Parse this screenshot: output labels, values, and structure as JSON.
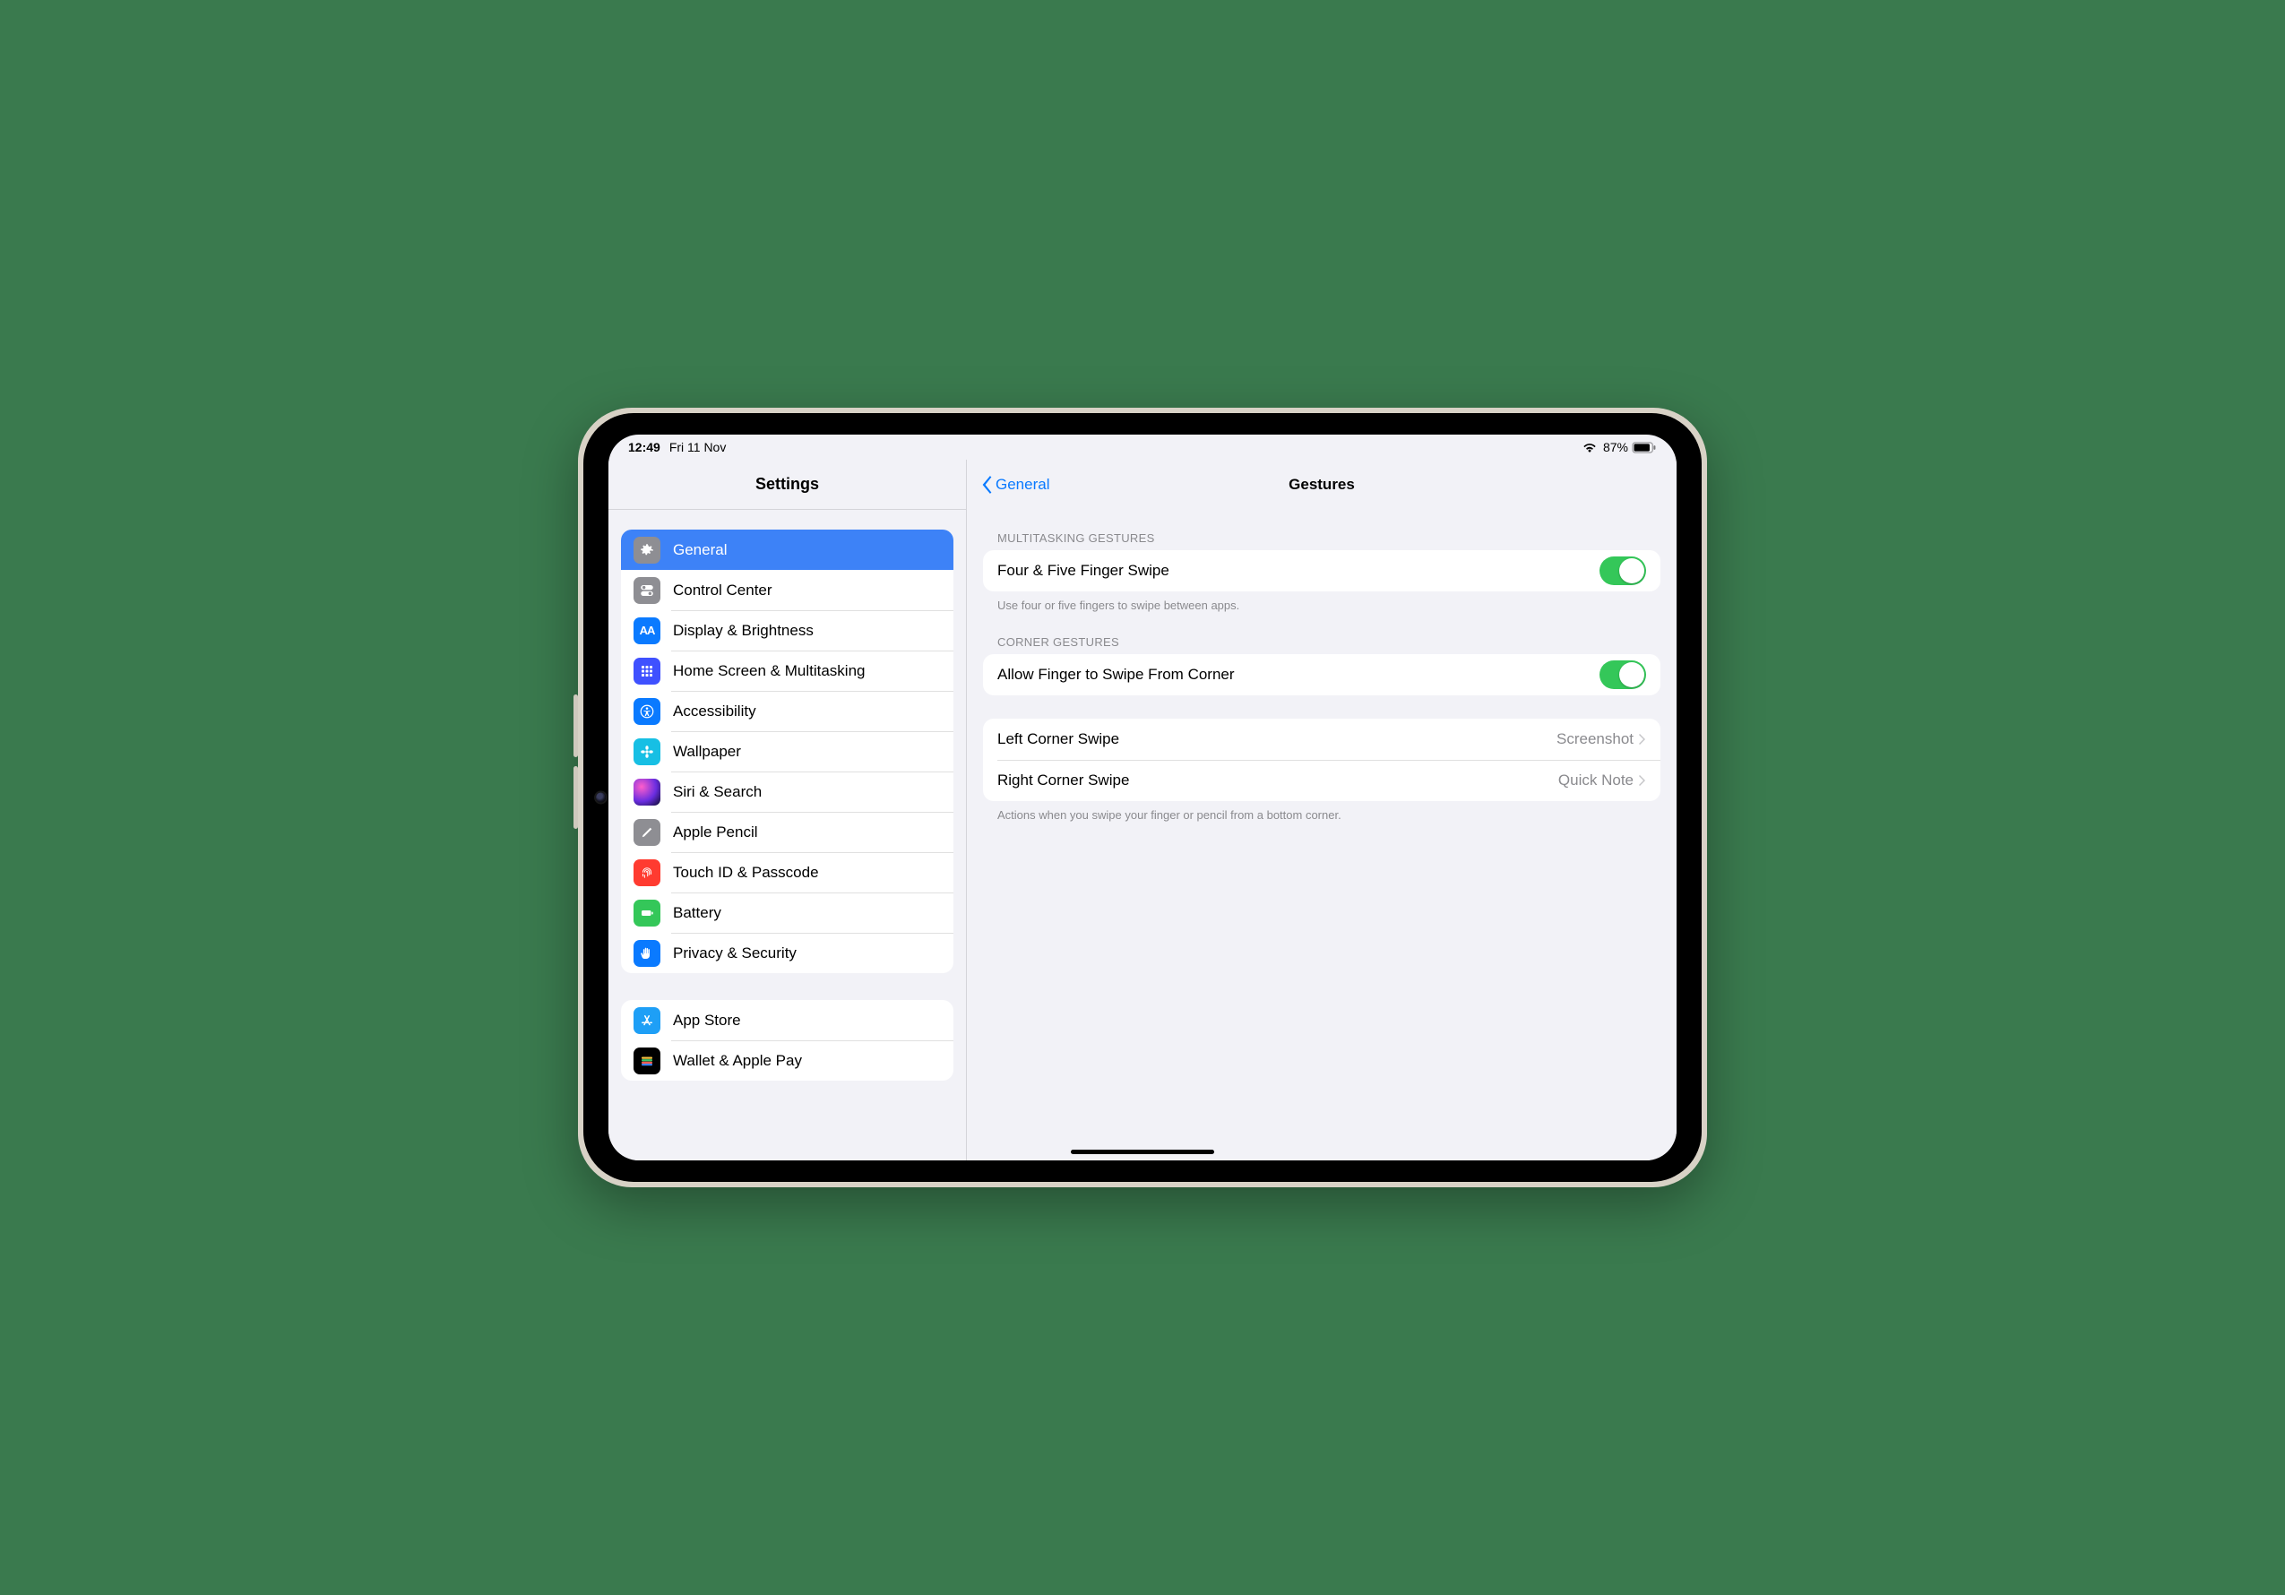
{
  "status": {
    "time": "12:49",
    "date": "Fri 11 Nov",
    "battery_pct": "87%"
  },
  "sidebar": {
    "title": "Settings",
    "group1": [
      {
        "label": "General"
      },
      {
        "label": "Control Center"
      },
      {
        "label": "Display & Brightness"
      },
      {
        "label": "Home Screen & Multitasking"
      },
      {
        "label": "Accessibility"
      },
      {
        "label": "Wallpaper"
      },
      {
        "label": "Siri & Search"
      },
      {
        "label": "Apple Pencil"
      },
      {
        "label": "Touch ID & Passcode"
      },
      {
        "label": "Battery"
      },
      {
        "label": "Privacy & Security"
      }
    ],
    "group2": [
      {
        "label": "App Store"
      },
      {
        "label": "Wallet & Apple Pay"
      }
    ]
  },
  "detail": {
    "back_label": "General",
    "title": "Gestures",
    "section1": {
      "header": "MULTITASKING GESTURES",
      "row_label": "Four & Five Finger Swipe",
      "footer": "Use four or five fingers to swipe between apps."
    },
    "section2": {
      "header": "CORNER GESTURES",
      "row_label": "Allow Finger to Swipe From Corner"
    },
    "section3": {
      "rows": [
        {
          "label": "Left Corner Swipe",
          "value": "Screenshot"
        },
        {
          "label": "Right Corner Swipe",
          "value": "Quick Note"
        }
      ],
      "footer": "Actions when you swipe your finger or pencil from a bottom corner."
    }
  }
}
